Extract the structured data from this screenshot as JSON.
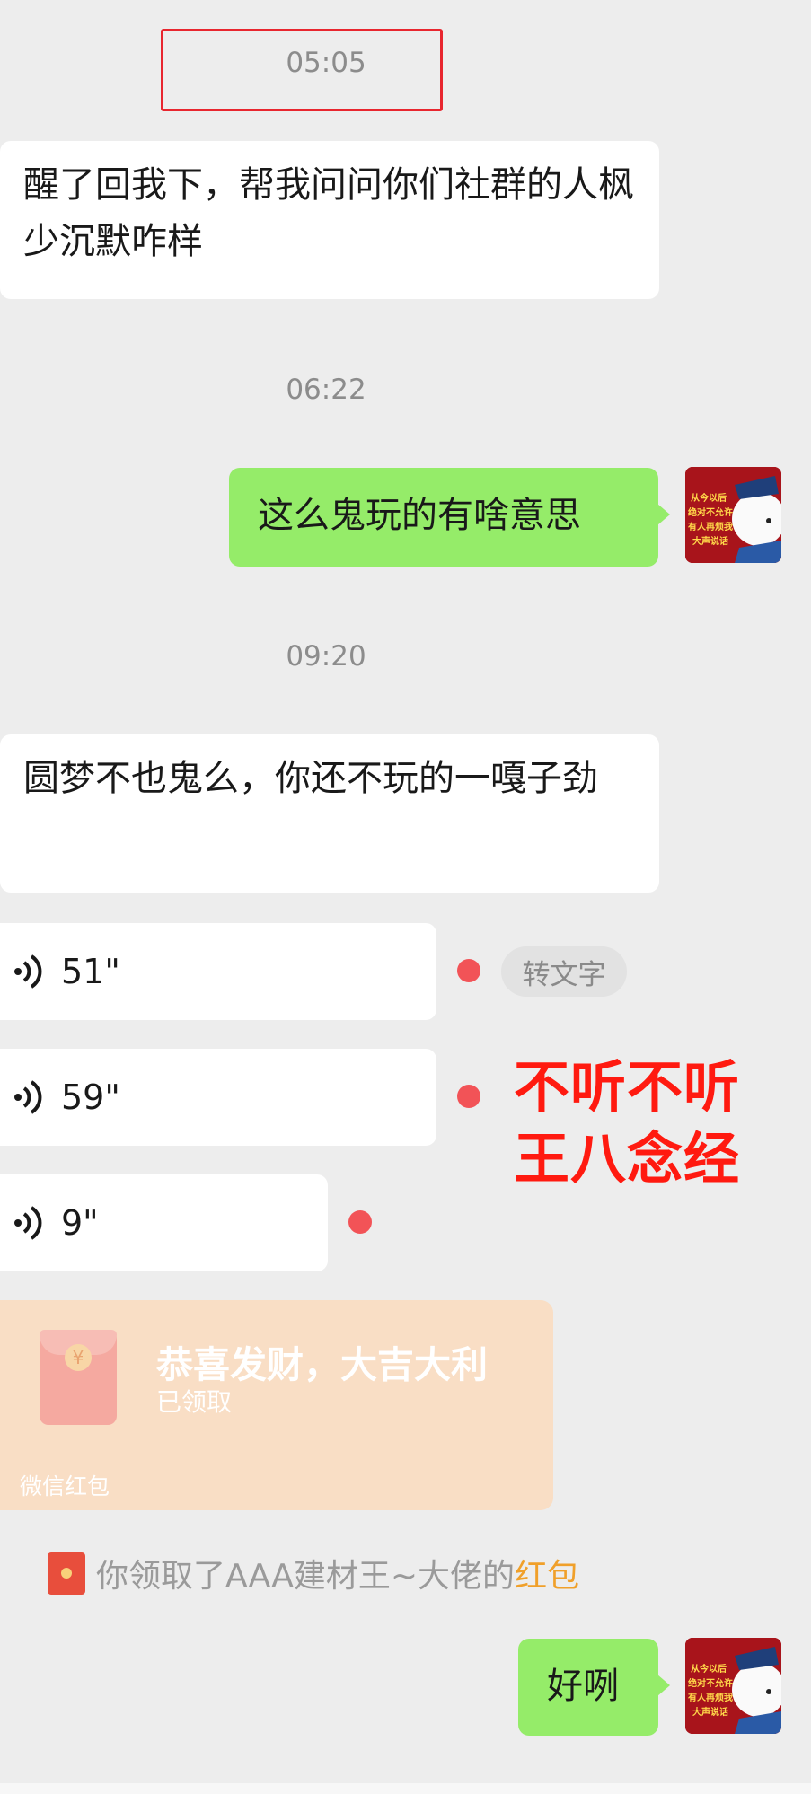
{
  "timestamps": [
    "05:05",
    "06:22",
    "09:20"
  ],
  "messages": {
    "m1": "醒了回我下，帮我问问你们社群的人枫少沉默咋样",
    "m2": "这么鬼玩的有啥意思",
    "m3": "圆梦不也鬼么，你还不玩的一嘎子劲",
    "m4": "好咧"
  },
  "voices": [
    {
      "duration": "51\""
    },
    {
      "duration": "59\""
    },
    {
      "duration": "9\""
    }
  ],
  "voice_to_text_label": "转文字",
  "annotation": {
    "line1": "不听不听",
    "line2": "王八念经"
  },
  "red_packet": {
    "title": "恭喜发财，大吉大利",
    "status": "已领取",
    "footer": "微信红包",
    "coin": "¥"
  },
  "system_notice": {
    "prefix": "你领取了AAA建材王~大佬的",
    "link": "红包"
  },
  "avatar_caption": [
    "从今以后",
    "绝对不允许",
    "有人再烦我",
    "大声说话"
  ],
  "colors": {
    "sent_bubble": "#95ec69",
    "received_bubble": "#ffffff",
    "background": "#ededed",
    "unread_dot": "#f25357",
    "annotation": "#ff1a10"
  }
}
